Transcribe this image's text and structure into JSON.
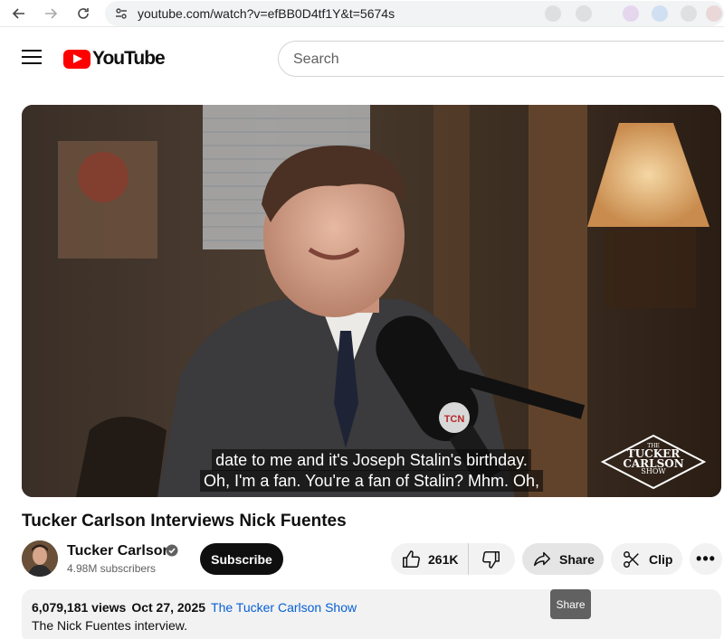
{
  "browser": {
    "url": "youtube.com/watch?v=efBB0D4tf1Y&t=5674s"
  },
  "header": {
    "logo_text": "YouTube",
    "search_placeholder": "Search"
  },
  "video": {
    "caption_line1": "date to me and it's Joseph Stalin's birthday.",
    "caption_line2": "Oh, I'm a fan. You're a fan of Stalin? Mhm. Oh,",
    "watermark": "THE TUCKER CARLSON SHOW",
    "mic_logo": "TCN"
  },
  "title": "Tucker Carlson Interviews Nick Fuentes",
  "owner": {
    "channel_name": "Tucker Carlson",
    "subscribers": "4.98M subscribers",
    "subscribe_label": "Subscribe"
  },
  "actions": {
    "like_count": "261K",
    "share_label": "Share",
    "clip_label": "Clip",
    "more_label": "•••",
    "tooltip": "Share"
  },
  "description": {
    "views": "6,079,181 views",
    "date": "Oct 27, 2025",
    "tagged_channel": "The Tucker Carlson Show",
    "text": "The Nick Fuentes interview."
  },
  "colors": {
    "brand_red": "#ff0000",
    "link_blue": "#065fd4"
  }
}
